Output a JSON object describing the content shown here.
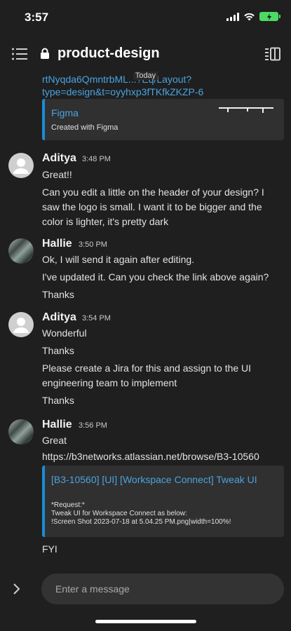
{
  "status": {
    "time": "3:57"
  },
  "header": {
    "channel": "product-design"
  },
  "divider": {
    "label": "Today"
  },
  "top_link": {
    "line1": "rtNyqda6QmntrbML...?Eq/Layout?",
    "line2": "type=design&t=oyyhxp3fTKfkZKZP-6"
  },
  "embed1": {
    "title": "Figma",
    "subtitle": "Created with Figma"
  },
  "messages": [
    {
      "sender": "Aditya",
      "time": "3:48 PM",
      "lines": [
        "Great!!",
        "Can you edit a little on the header of your design? I saw the logo is small. I want it to be bigger and the color is lighter, it's pretty dark"
      ]
    },
    {
      "sender": "Hallie",
      "time": "3:50 PM",
      "lines": [
        "Ok, I will send it again after editing.",
        "I've updated it. Can you check the link above again?",
        "Thanks"
      ]
    },
    {
      "sender": "Aditya",
      "time": "3:54 PM",
      "lines": [
        "Wonderful",
        "Thanks",
        "Please create a Jira for this and assign to the UI engineering team to implement",
        "Thanks"
      ]
    },
    {
      "sender": "Hallie",
      "time": "3:56 PM",
      "lines": [
        "Great",
        "https://b3networks.atlassian.net/browse/B3-10560",
        "FYI"
      ]
    }
  ],
  "embed2": {
    "title": "[B3-10560] [UI] [Workspace Connect] Tweak UI",
    "line1": "*Request:*",
    "line2": "Tweak UI for Workspace Connect as below:",
    "line3": "!Screen Shot 2023-07-18 at 5.04.25 PM.png|width=100%!"
  },
  "composer": {
    "placeholder": "Enter a message"
  },
  "colors": {
    "background": "#1f1f1f",
    "link": "#4aa3df",
    "embed_accent": "#1a8cd8",
    "battery": "#4cd964"
  },
  "icons": [
    "menu-icon",
    "lock-icon",
    "panel-icon",
    "chevron-right-icon",
    "wifi-icon",
    "signal-icon",
    "battery-icon"
  ]
}
